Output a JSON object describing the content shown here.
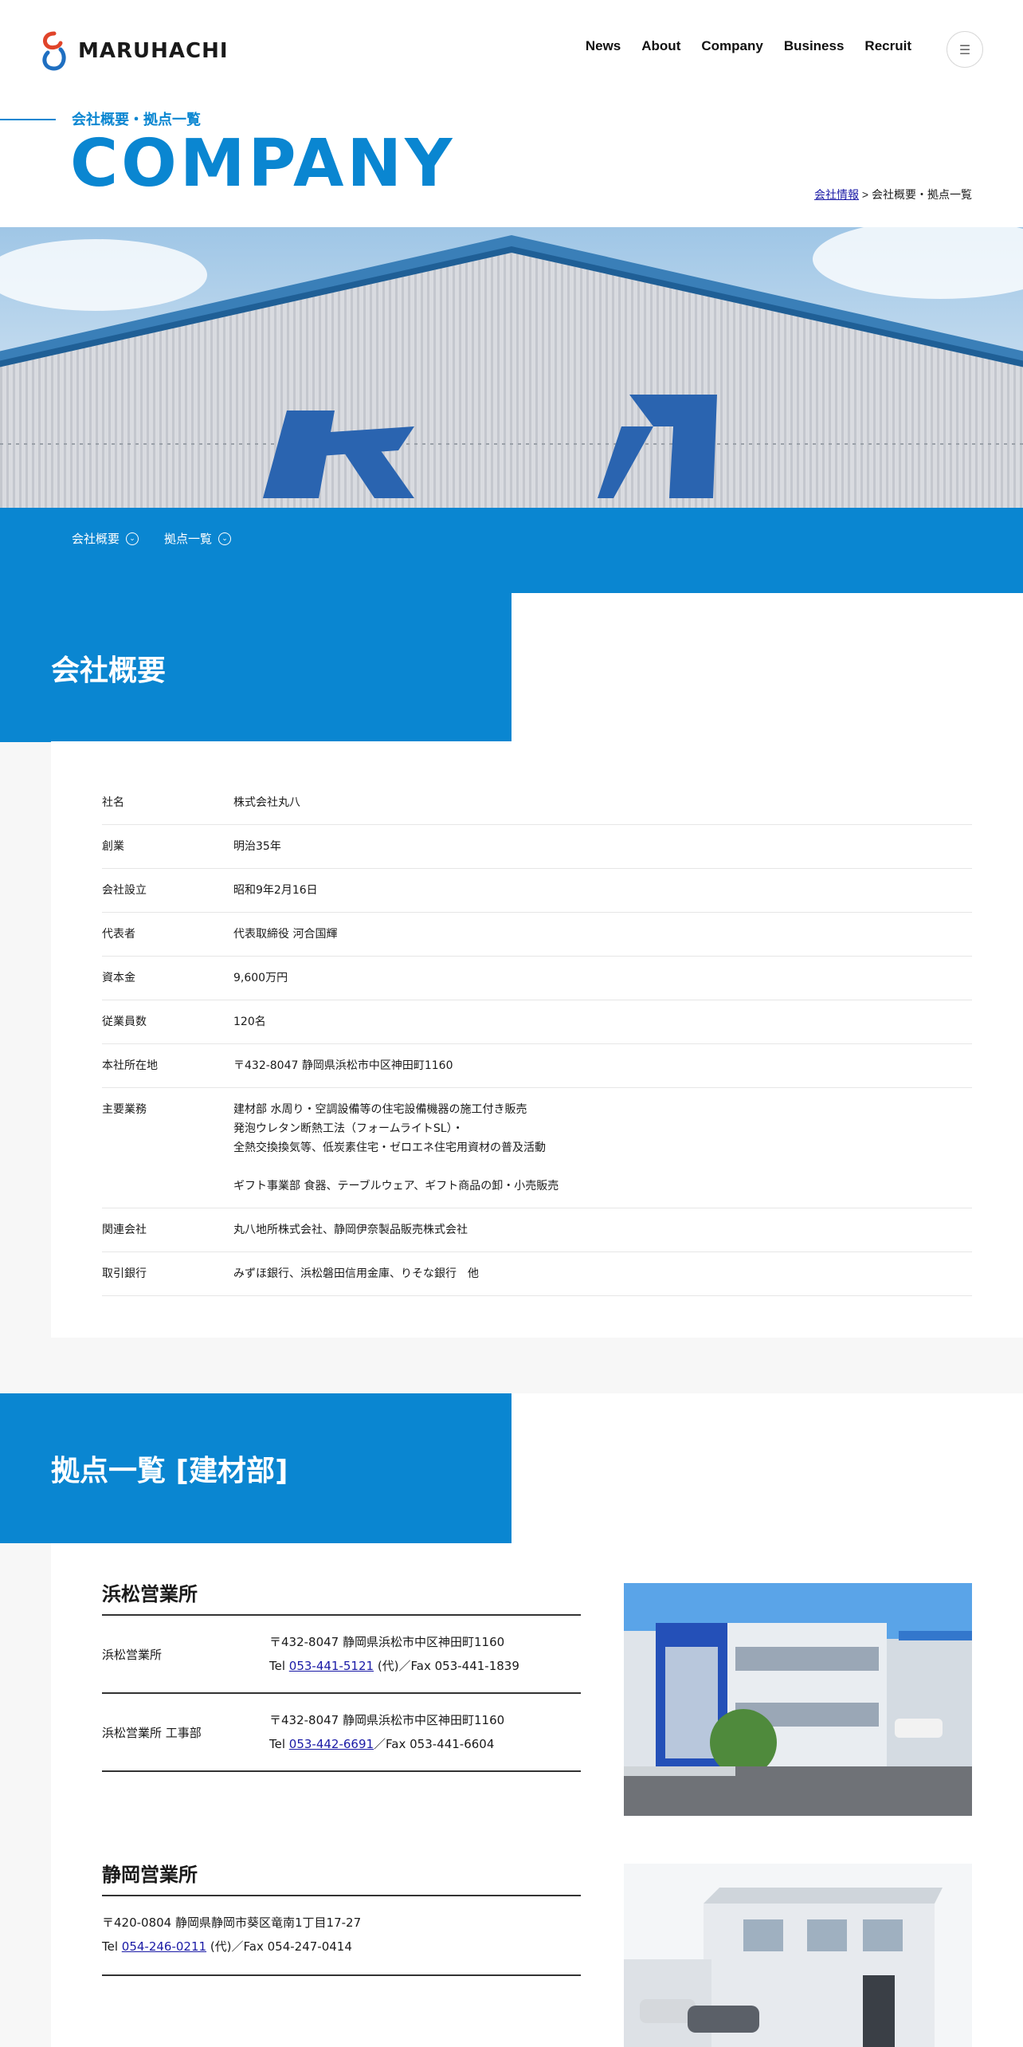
{
  "header": {
    "brand": "MARUHACHI",
    "nav": [
      "News",
      "About",
      "Company",
      "Business",
      "Recruit"
    ],
    "menu_icon": "hamburger-icon"
  },
  "page": {
    "eyebrow": "会社概要・拠点一覧",
    "title": "COMPANY"
  },
  "breadcrumb": {
    "link": "会社情報",
    "separator": " > ",
    "current": "会社概要・拠点一覧"
  },
  "hero": {
    "sign_left": "丸",
    "sign_right": "八"
  },
  "subnav": [
    {
      "label": "会社概要",
      "icon": "chevron-down-circle-icon"
    },
    {
      "label": "拠点一覧",
      "icon": "chevron-down-circle-icon"
    }
  ],
  "overview": {
    "heading": "会社概要",
    "rows": [
      {
        "key": "社名",
        "value": "株式会社丸八"
      },
      {
        "key": "創業",
        "value": "明治35年"
      },
      {
        "key": "会社設立",
        "value": "昭和9年2月16日"
      },
      {
        "key": "代表者",
        "value": "代表取締役 河合国輝"
      },
      {
        "key": "資本金",
        "value": "9,600万円"
      },
      {
        "key": "従業員数",
        "value": "120名"
      },
      {
        "key": "本社所在地",
        "value": "〒432-8047 静岡県浜松市中区神田町1160"
      },
      {
        "key": "主要業務",
        "value": "建材部 水周り・空調設備等の住宅設備機器の施工付き販売\n発泡ウレタン断熱工法（フォームライトSL）・\n全熱交換換気等、低炭素住宅・ゼロエネ住宅用資材の普及活動\n\nギフト事業部 食器、テーブルウェア、ギフト商品の卸・小売販売"
      },
      {
        "key": "関連会社",
        "value": "丸八地所株式会社、静岡伊奈製品販売株式会社"
      },
      {
        "key": "取引銀行",
        "value": "みずほ銀行、浜松磐田信用金庫、りそな銀行　他"
      }
    ]
  },
  "bases": {
    "heading": "拠点一覧 [建材部]",
    "hamamatsu": {
      "title": "浜松営業所",
      "rows": [
        {
          "name": "浜松営業所",
          "address": "〒432-8047 静岡県浜松市中区神田町1160",
          "tel_prefix": "Tel ",
          "tel": "053-441-5121",
          "suffix": " (代)／Fax 053-441-1839"
        },
        {
          "name": "浜松営業所 工事部",
          "address": "〒432-8047 静岡県浜松市中区神田町1160",
          "tel_prefix": "Tel ",
          "tel": "053-442-6691",
          "suffix": "／Fax 053-441-6604"
        }
      ]
    },
    "shizuoka": {
      "title": "静岡営業所",
      "address": "〒420-0804 静岡県静岡市葵区竜南1丁目17-27",
      "tel_prefix": "Tel ",
      "tel": "054-246-0211",
      "suffix": " (代)／Fax 054-247-0414"
    }
  },
  "colors": {
    "brand_blue": "#0a86d1",
    "logo_red": "#e0442a",
    "logo_blue": "#1f6fc1",
    "text": "#1a1a1a",
    "gray_bg": "#f7f7f7"
  }
}
